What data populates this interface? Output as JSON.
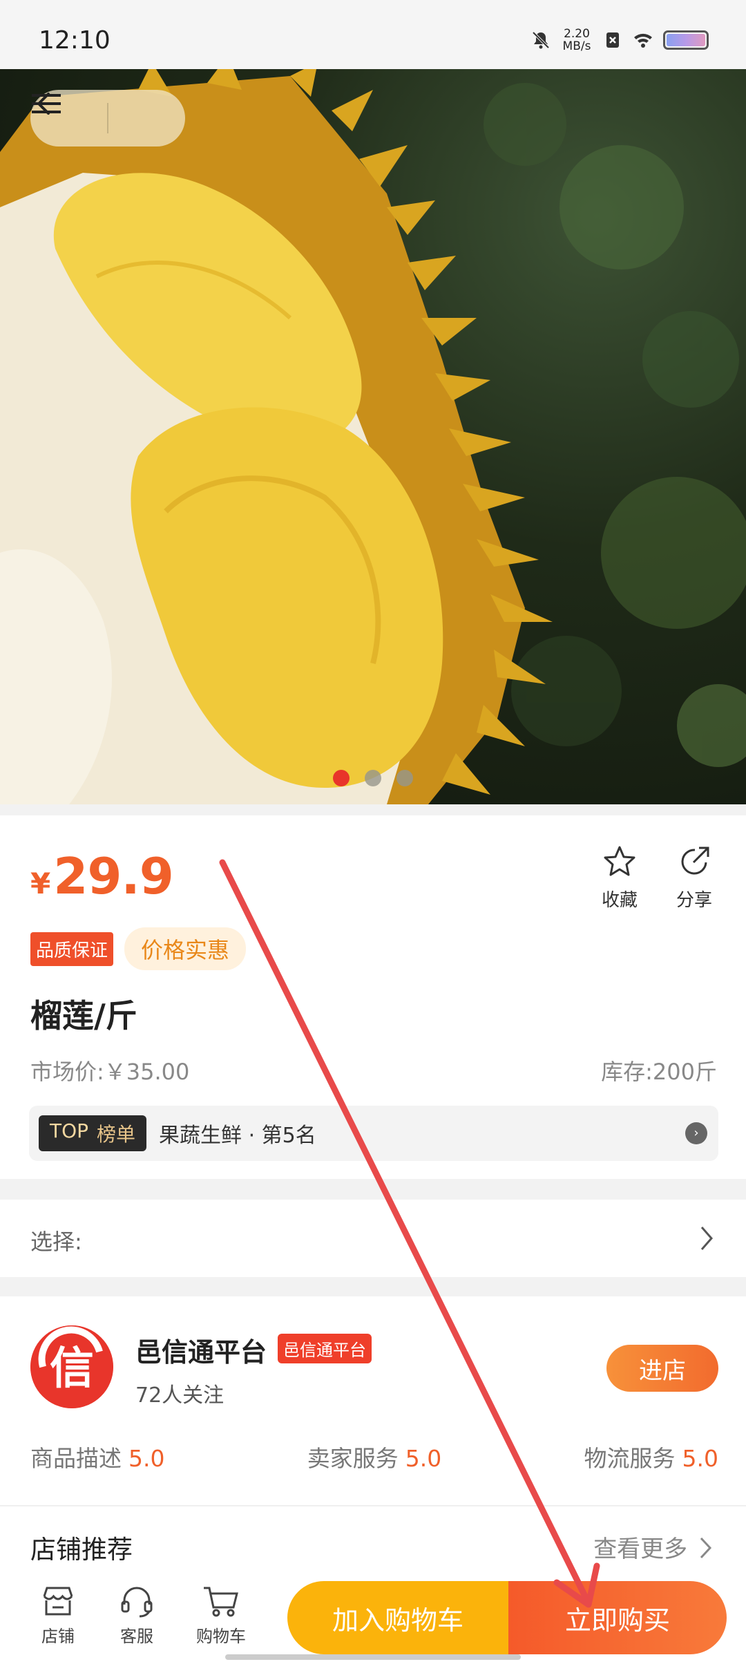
{
  "status_bar": {
    "time": "12:10",
    "net_speed_value": "2.20",
    "net_speed_unit": "MB/s",
    "icons": [
      "mute-icon",
      "sim-off-icon",
      "wifi-icon",
      "battery-icon"
    ]
  },
  "hero": {
    "image_subject": "durian",
    "dots_count": 3,
    "active_dot": 0,
    "nav_icons": [
      "back-icon",
      "menu-icon"
    ]
  },
  "product": {
    "currency": "¥",
    "price": "29.9",
    "favorite_label": "收藏",
    "share_label": "分享",
    "badge_quality": "品质保证",
    "badge_deal": "价格实惠",
    "title": "榴莲/斤",
    "market_price": "市场价:￥35.00",
    "stock": "库存:200斤",
    "rank_top": "TOP",
    "rank_board": "榜单",
    "rank_text": "果蔬生鲜 · 第5名"
  },
  "select": {
    "label": "选择:"
  },
  "shop": {
    "logo_char": "信",
    "name": "邑信通平台",
    "tag": "邑信通平台",
    "followers": "72人关注",
    "enter_label": "进店",
    "ratings": [
      {
        "label": "商品描述",
        "value": "5.0"
      },
      {
        "label": "卖家服务",
        "value": "5.0"
      },
      {
        "label": "物流服务",
        "value": "5.0"
      }
    ],
    "recommend_title": "店铺推荐",
    "recommend_more": "查看更多"
  },
  "bottom_bar": {
    "tabs": [
      {
        "label": "店铺",
        "icon": "store-icon"
      },
      {
        "label": "客服",
        "icon": "headset-icon"
      },
      {
        "label": "购物车",
        "icon": "cart-icon"
      }
    ],
    "add_to_cart": "加入购物车",
    "buy_now": "立即购买"
  },
  "colors": {
    "accent": "#f0602a",
    "cart_button": "#fbb30b",
    "buy_button": "#f55a2a",
    "annotation_arrow": "#e84a4a"
  }
}
